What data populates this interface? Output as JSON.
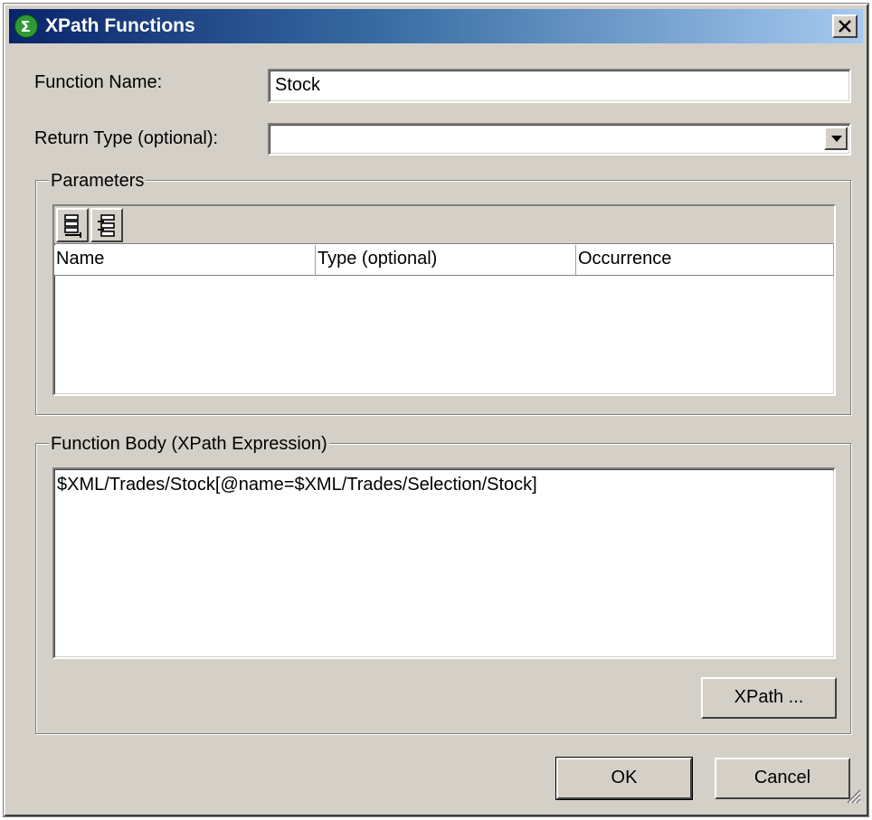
{
  "window": {
    "title": "XPath Functions",
    "close_glyph": "✕",
    "icon": "xpath-function-icon"
  },
  "form": {
    "function_name_label": "Function Name:",
    "function_name_value": "Stock",
    "return_type_label": "Return Type (optional):",
    "return_type_value": ""
  },
  "parameters": {
    "group_label": "Parameters",
    "toolbar": {
      "append_icon": "append-parameter-icon",
      "insert_icon": "insert-parameter-icon"
    },
    "columns": [
      "Name",
      "Type (optional)",
      "Occurrence"
    ],
    "rows": []
  },
  "body": {
    "group_label": "Function Body (XPath Expression)",
    "expression": "$XML/Trades/Stock[@name=$XML/Trades/Selection/Stock]",
    "xpath_button": "XPath ..."
  },
  "buttons": {
    "ok": "OK",
    "cancel": "Cancel"
  },
  "colors": {
    "dialog_bg": "#d4d0c8",
    "titlebar_start": "#0a246a",
    "titlebar_end": "#a6caf0",
    "icon_green": "#2f9a35"
  }
}
